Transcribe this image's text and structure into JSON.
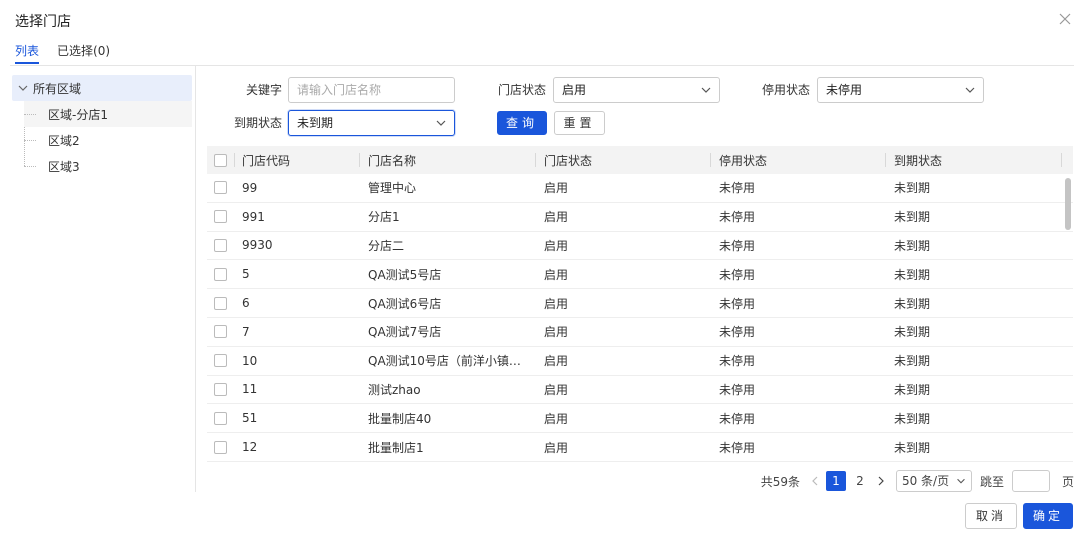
{
  "dialog": {
    "title": "选择门店"
  },
  "tabs": [
    {
      "label": "列表",
      "active": true
    },
    {
      "label": "已选择(0)",
      "active": false
    }
  ],
  "tree": {
    "root": "所有区域",
    "children": [
      "区域-分店1",
      "区域2",
      "区域3"
    ]
  },
  "filters": {
    "keyword_label": "关键字",
    "keyword_placeholder": "请输入门店名称",
    "store_status_label": "门店状态",
    "store_status_value": "启用",
    "suspend_status_label": "停用状态",
    "suspend_status_value": "未停用",
    "expire_status_label": "到期状态",
    "expire_status_value": "未到期",
    "search_button": "查询",
    "reset_button": "重置"
  },
  "table": {
    "columns": [
      "门店代码",
      "门店名称",
      "门店状态",
      "停用状态",
      "到期状态"
    ],
    "rows": [
      [
        "99",
        "管理中心",
        "启用",
        "未停用",
        "未到期"
      ],
      [
        "991",
        "分店1",
        "启用",
        "未停用",
        "未到期"
      ],
      [
        "9930",
        "分店二",
        "启用",
        "未停用",
        "未到期"
      ],
      [
        "5",
        "QA测试5号店",
        "启用",
        "未停用",
        "未到期"
      ],
      [
        "6",
        "QA测试6号店",
        "启用",
        "未停用",
        "未到期"
      ],
      [
        "7",
        "QA测试7号店",
        "启用",
        "未停用",
        "未到期"
      ],
      [
        "10",
        "QA测试10号店（前洋小镇…",
        "启用",
        "未停用",
        "未到期"
      ],
      [
        "11",
        "测试zhao",
        "启用",
        "未停用",
        "未到期"
      ],
      [
        "51",
        "批量制店40",
        "启用",
        "未停用",
        "未到期"
      ],
      [
        "12",
        "批量制店1",
        "启用",
        "未停用",
        "未到期"
      ]
    ]
  },
  "pagination": {
    "total_text": "共59条",
    "pages": [
      "1",
      "2"
    ],
    "current_page": "1",
    "page_size": "50 条/页",
    "jump_label": "跳至",
    "page_suffix": "页"
  },
  "footer": {
    "cancel": "取消",
    "confirm": "确定"
  },
  "colors": {
    "primary": "#1a56db"
  }
}
